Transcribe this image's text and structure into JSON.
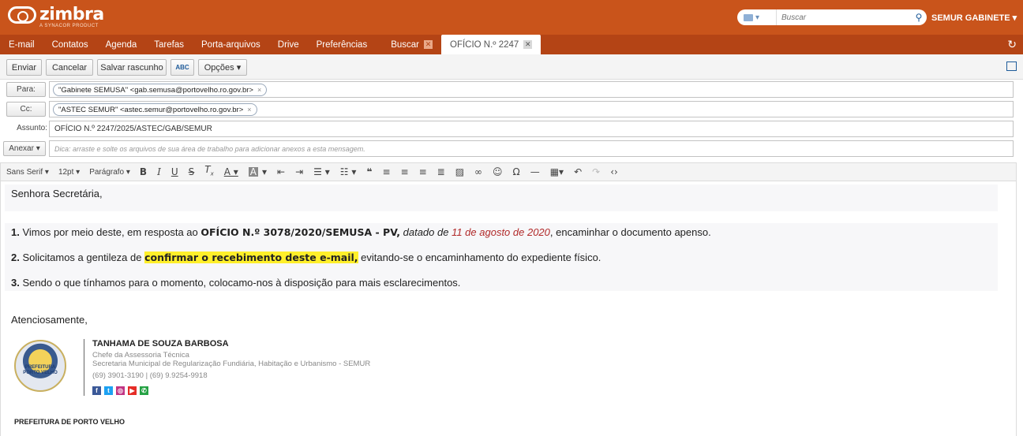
{
  "header": {
    "logo_text": "zimbra",
    "logo_sub": "A SYNACOR PRODUCT",
    "search_placeholder": "Buscar",
    "user": "SEMUR GABINETE ▾"
  },
  "nav": {
    "items": [
      "E-mail",
      "Contatos",
      "Agenda",
      "Tarefas",
      "Porta-arquivos",
      "Drive",
      "Preferências"
    ],
    "tabs": [
      "Buscar",
      "OFÍCIO N.º 2247"
    ],
    "close_glyph": "✕",
    "refresh_glyph": "↻"
  },
  "toolbar": {
    "send": "Enviar",
    "cancel": "Cancelar",
    "save_draft": "Salvar rascunho",
    "spell_check": "ABC",
    "options": "Opções ▾"
  },
  "fields": {
    "to_label": "Para:",
    "to_value": "\"Gabinete SEMUSA\" <gab.semusa@portovelho.ro.gov.br>",
    "cc_label": "Cc:",
    "cc_value": "\"ASTEC SEMUR\" <astec.semur@portovelho.ro.gov.br>",
    "subject_label": "Assunto:",
    "subject_value": "OFÍCIO N.º 2247/2025/ASTEC/GAB/SEMUR",
    "attach_label": "Anexar ▾",
    "attach_hint": "Dica: arraste e solte os arquivos de sua área de trabalho para adicionar anexos a esta mensagem.",
    "remove_glyph": "×"
  },
  "editor": {
    "font_family": "Sans Serif ▾",
    "font_size": "12pt ▾",
    "paragraph": "Parágrafo ▾",
    "icons": [
      "bold-icon",
      "italic-icon",
      "underline-icon",
      "strikethrough-icon",
      "clear-format-icon",
      "text-color-icon",
      "background-color-icon",
      "outdent-icon",
      "indent-icon",
      "bullet-list-icon",
      "numbered-list-icon",
      "blockquote-icon",
      "align-left-icon",
      "align-center-icon",
      "align-right-icon",
      "justify-icon",
      "image-icon",
      "link-icon",
      "emoticon-icon",
      "special-char-icon",
      "horizontal-rule-icon",
      "table-icon",
      "undo-icon",
      "redo-icon",
      "source-code-icon"
    ]
  },
  "body": {
    "greeting": "Senhora Secretária,",
    "p1_num": "1.",
    "p1_a": " Vimos por meio deste, em resposta ao ",
    "p1_b": "OFÍCIO N.º 3078/2020/SEMUSA - PV,",
    "p1_c": " datado de ",
    "p1_d": "11 de agosto de 2020",
    "p1_e": ", encaminhar o documento apenso.",
    "p2_num": "2.",
    "p2_a": " Solicitamos a gentileza de ",
    "p2_b": "confirmar o recebimento deste e-mail,",
    "p2_c": " evitando-se o encaminhamento do expediente físico.",
    "p3_num": "3.",
    "p3_a": " Sendo o que tínhamos para o momento, colocamo-nos à disposição para mais esclarecimentos.",
    "closing": "Atenciosamente,"
  },
  "signature": {
    "seal_text": "PREFEITURA\nPORTO VELHO",
    "name": "TANHAMA DE SOUZA BARBOSA",
    "role": "Chefe da Assessoria Técnica",
    "dept": "Secretaria Municipal de Regularização Fundiária, Habitação e Urbanismo - SEMUR",
    "phones": "(69) 3901-3190 | (69) 9.9254-9918",
    "social": [
      {
        "name": "facebook",
        "glyph": "f",
        "color": "#3b5998"
      },
      {
        "name": "twitter",
        "glyph": "t",
        "color": "#1da1f2"
      },
      {
        "name": "instagram",
        "glyph": "◎",
        "color": "#c13584"
      },
      {
        "name": "youtube",
        "glyph": "▶",
        "color": "#e52d27"
      },
      {
        "name": "whatsapp",
        "glyph": "✆",
        "color": "#25a244"
      }
    ],
    "org": "PREFEITURA DE PORTO VELHO"
  }
}
